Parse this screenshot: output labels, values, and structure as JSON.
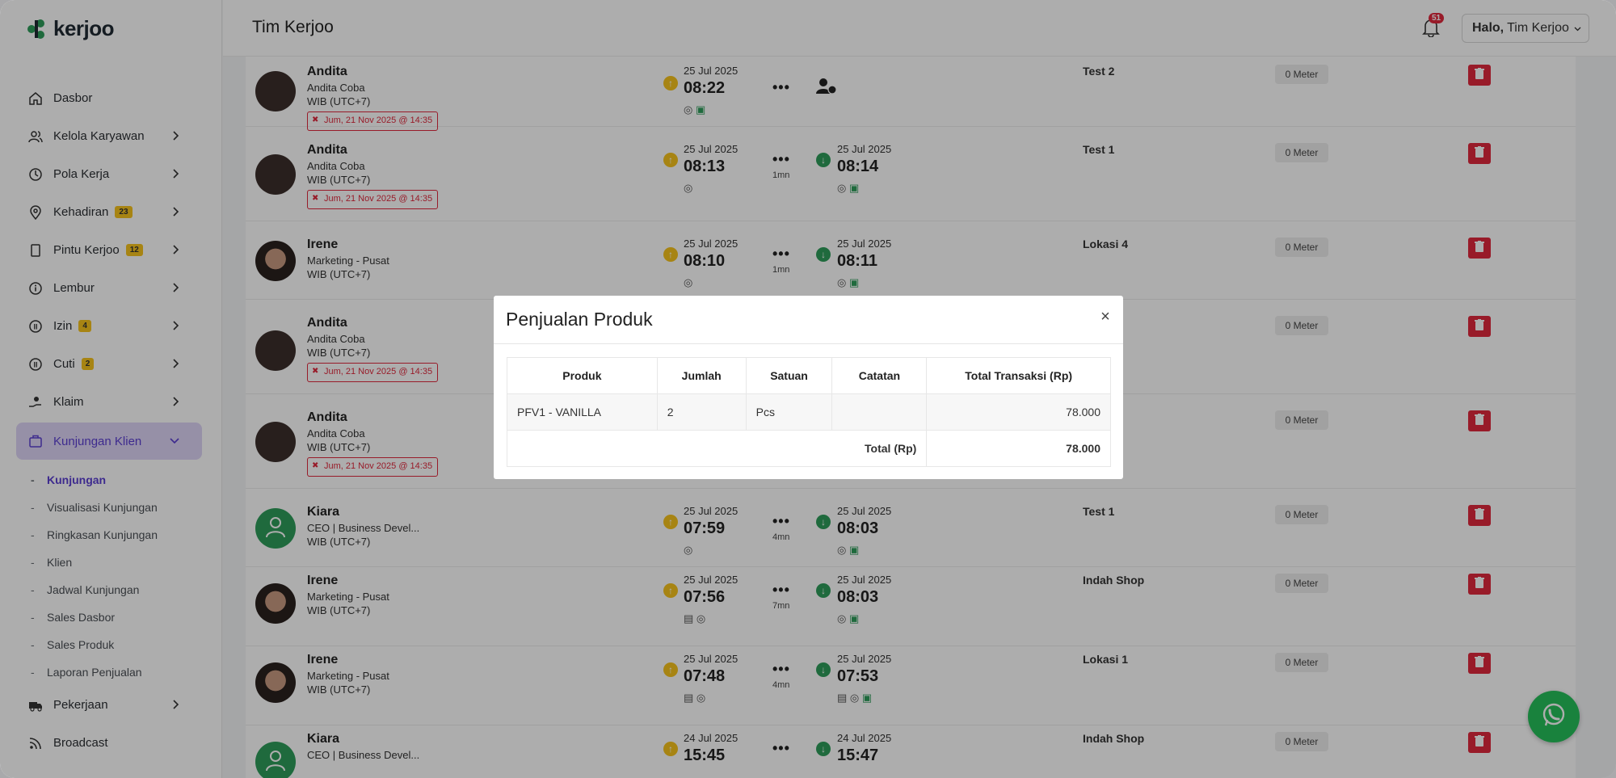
{
  "app": {
    "brand": "kerjoo",
    "page_title": "Tim Kerjoo",
    "notification_count": "51",
    "greeting_bold": "Halo,",
    "user_name": "Tim Kerjoo"
  },
  "sidebar": {
    "items": [
      {
        "label": "Dasbor",
        "icon": "home-icon"
      },
      {
        "label": "Kelola Karyawan",
        "icon": "users-icon"
      },
      {
        "label": "Pola Kerja",
        "icon": "clock-icon"
      },
      {
        "label": "Kehadiran",
        "icon": "location-pin-icon",
        "badge": "23"
      },
      {
        "label": "Pintu Kerjoo",
        "icon": "door-icon",
        "badge": "12"
      },
      {
        "label": "Lembur",
        "icon": "info-icon"
      },
      {
        "label": "Izin",
        "icon": "circle-i-icon",
        "badge": "4"
      },
      {
        "label": "Cuti",
        "icon": "circle-c-icon",
        "badge": "2"
      },
      {
        "label": "Klaim",
        "icon": "hand-coin-icon"
      },
      {
        "label": "Kunjungan Klien",
        "icon": "briefcase-icon"
      }
    ],
    "sub_items": [
      "Kunjungan",
      "Visualisasi Kunjungan",
      "Ringkasan Kunjungan",
      "Klien",
      "Jadwal Kunjungan",
      "Sales Dasbor",
      "Sales Produk",
      "Laporan Penjualan"
    ],
    "bottom_items": [
      {
        "label": "Pekerjaan",
        "icon": "truck-icon"
      },
      {
        "label": "Broadcast",
        "icon": "rss-icon"
      }
    ]
  },
  "rows": [
    {
      "name": "Andita",
      "job": "Andita Coba",
      "tz": "WIB (UTC+7)",
      "tag": "Jum, 21 Nov 2025 @ 14:35",
      "in_date": "25 Jul 2025",
      "in_time": "08:22",
      "out_date": "",
      "out_time": "",
      "dur": "",
      "loc": "Test 2",
      "meter": "0 Meter"
    },
    {
      "name": "Andita",
      "job": "Andita Coba",
      "tz": "WIB (UTC+7)",
      "tag": "Jum, 21 Nov 2025 @ 14:35",
      "in_date": "25 Jul 2025",
      "in_time": "08:13",
      "out_date": "25 Jul 2025",
      "out_time": "08:14",
      "dur": "1mn",
      "loc": "Test 1",
      "meter": "0 Meter"
    },
    {
      "name": "Irene",
      "job": "Marketing - Pusat",
      "tz": "WIB (UTC+7)",
      "tag": "",
      "in_date": "25 Jul 2025",
      "in_time": "08:10",
      "out_date": "25 Jul 2025",
      "out_time": "08:11",
      "dur": "1mn",
      "loc": "Lokasi 4",
      "meter": "0 Meter"
    },
    {
      "name": "Andita",
      "job": "Andita Coba",
      "tz": "WIB (UTC+7)",
      "tag": "Jum, 21 Nov 2025 @ 14:35",
      "in_date": "",
      "in_time": "",
      "out_date": "",
      "out_time": "",
      "dur": "",
      "loc": "",
      "meter": "0 Meter"
    },
    {
      "name": "Andita",
      "job": "Andita Coba",
      "tz": "WIB (UTC+7)",
      "tag": "Jum, 21 Nov 2025 @ 14:35",
      "in_date": "",
      "in_time": "",
      "out_date": "",
      "out_time": "",
      "dur": "",
      "loc": "",
      "meter": "0 Meter"
    },
    {
      "name": "Kiara",
      "job": "CEO | Business Devel...",
      "tz": "WIB (UTC+7)",
      "tag": "",
      "in_date": "25 Jul 2025",
      "in_time": "07:59",
      "out_date": "25 Jul 2025",
      "out_time": "08:03",
      "dur": "4mn",
      "loc": "Test 1",
      "meter": "0 Meter"
    },
    {
      "name": "Irene",
      "job": "Marketing - Pusat",
      "tz": "WIB (UTC+7)",
      "tag": "",
      "in_date": "25 Jul 2025",
      "in_time": "07:56",
      "out_date": "25 Jul 2025",
      "out_time": "08:03",
      "dur": "7mn",
      "loc": "Indah Shop",
      "meter": "0 Meter"
    },
    {
      "name": "Irene",
      "job": "Marketing - Pusat",
      "tz": "WIB (UTC+7)",
      "tag": "",
      "in_date": "25 Jul 2025",
      "in_time": "07:48",
      "out_date": "25 Jul 2025",
      "out_time": "07:53",
      "dur": "4mn",
      "loc": "Lokasi 1",
      "meter": "0 Meter"
    },
    {
      "name": "Kiara",
      "job": "CEO | Business Devel...",
      "tz": "",
      "tag": "",
      "in_date": "24 Jul 2025",
      "in_time": "15:45",
      "out_date": "24 Jul 2025",
      "out_time": "15:47",
      "dur": "",
      "loc": "Indah Shop",
      "meter": "0 Meter"
    }
  ],
  "modal": {
    "title": "Penjualan Produk",
    "close_glyph": "×",
    "columns": [
      "Produk",
      "Jumlah",
      "Satuan",
      "Catatan",
      "Total Transaksi (Rp)"
    ],
    "rows": [
      {
        "produk": "PFV1 - VANILLA",
        "jumlah": "2",
        "satuan": "Pcs",
        "catatan": "",
        "total": "78.000"
      }
    ],
    "footer_label": "Total (Rp)",
    "footer_value": "78.000"
  },
  "colors": {
    "accent": "#5b3fd1",
    "danger": "#e0293d",
    "warning": "#f6c31d",
    "success": "#2e9d5a",
    "whatsapp": "#25c05a"
  }
}
